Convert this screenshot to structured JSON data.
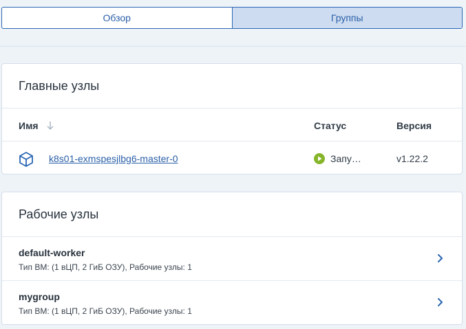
{
  "tabs": [
    {
      "label": "Обзор",
      "active": false
    },
    {
      "label": "Группы",
      "active": true
    }
  ],
  "masters": {
    "title": "Главные узлы",
    "columns": {
      "name": "Имя",
      "status": "Статус",
      "version": "Версия"
    },
    "rows": [
      {
        "name": "k8s01-exmspesjlbg6-master-0",
        "status": "Запу…",
        "version": "v1.22.2",
        "status_color": "#86b52a"
      }
    ]
  },
  "workers": {
    "title": "Рабочие узлы",
    "groups": [
      {
        "name": "default-worker",
        "description": "Тип ВМ: (1 вЦП, 2 ГиБ ОЗУ), Рабочие узлы: 1"
      },
      {
        "name": "mygroup",
        "description": "Тип ВМ: (1 вЦП, 2 ГиБ ОЗУ), Рабочие узлы: 1"
      }
    ]
  },
  "icons": {
    "node": "cube-icon",
    "sort": "arrow-down-icon",
    "status": "play-circle-icon",
    "row_chevron": "chevron-right-icon"
  },
  "colors": {
    "accent": "#2a5fa8",
    "tab_active_bg": "#cddcf0",
    "page_bg": "#eef3f8"
  }
}
